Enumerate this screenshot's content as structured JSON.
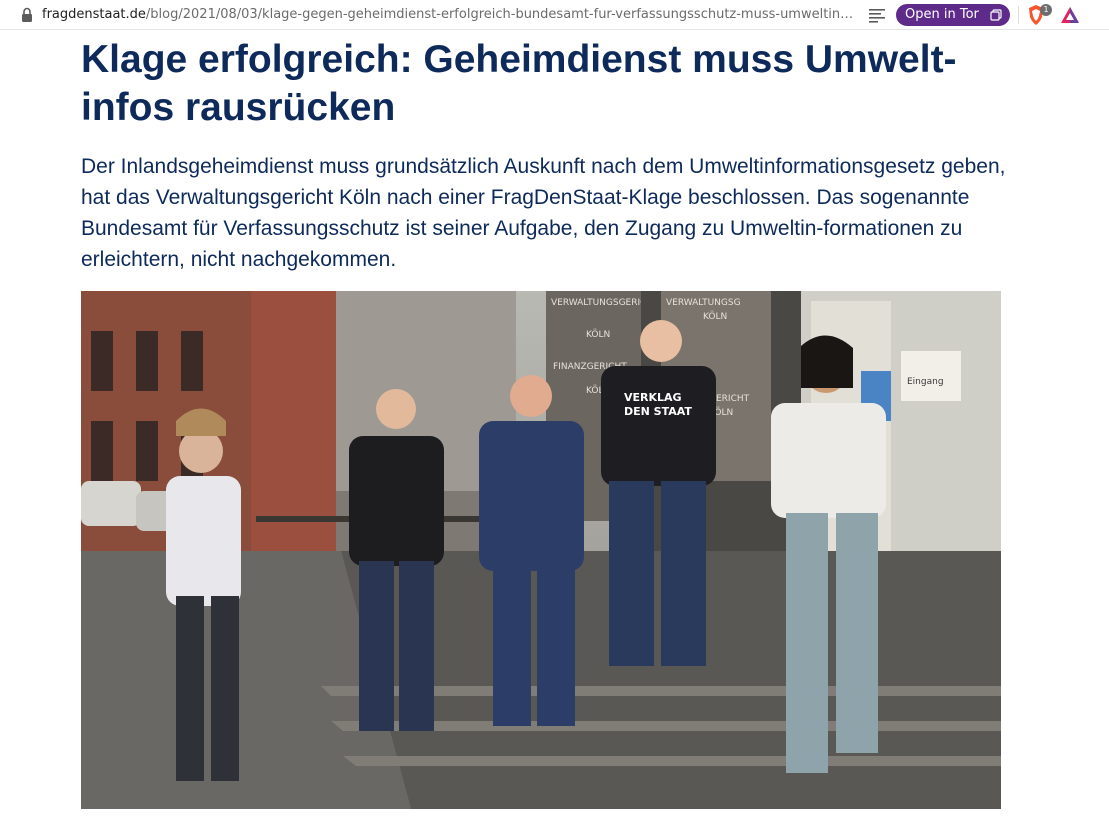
{
  "browser": {
    "url_host": "fragdenstaat.de",
    "url_path": "/blog/2021/08/03/klage-gegen-geheimdienst-erfolgreich-bundesamt-fur-verfassungsschutz-muss-umweltinfos...",
    "tor_button_label": "Open in Tor",
    "shields_badge": "1",
    "icons": [
      "lock-icon",
      "reader-mode-icon",
      "private-window-icon",
      "brave-shields-icon",
      "brave-rewards-icon"
    ],
    "accent_color": "#5e2b8a"
  },
  "article": {
    "title": "Klage erfolgreich: Geheimdienst muss Umwelt-infos rausrücken",
    "lead": "Der Inlandsgeheimdienst muss grundsätzlich Auskunft nach dem Umweltinformationsgesetz geben, hat das Verwaltungsgericht Köln nach einer FragDenStaat-Klage beschlossen. Das sogenannte Bundesamt für Verfassungsschutz ist seiner Aufgabe, den Zugang zu Umweltin-formationen zu erleichtern, nicht nachgekommen.",
    "title_color": "#0d2a5a"
  },
  "photo": {
    "sign_court_1": "VERWALTUNGSGERICHT",
    "sign_court_1_city": "KÖLN",
    "sign_court_2": "FINANZGERICHT",
    "sign_court_2_city": "KÖLN",
    "sign_right_1": "VERWALTUNGSG",
    "sign_right_2": "KÖLN",
    "sign_right_3": "GERICHT",
    "sign_right_4": "KÖLN",
    "door_sign": "Eingang",
    "shirt_1": "VERKLAG",
    "shirt_2": "DEN STAAT"
  }
}
